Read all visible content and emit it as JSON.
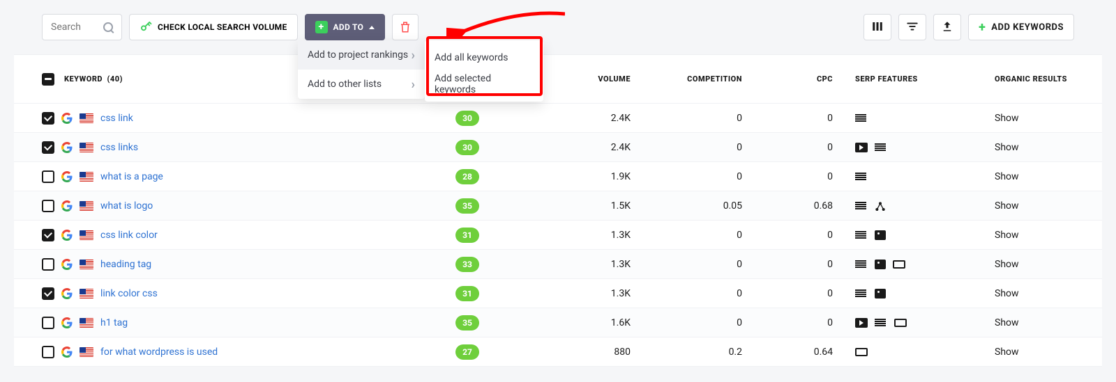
{
  "toolbar": {
    "search_placeholder": "Search",
    "check_local": "CHECK LOCAL SEARCH VOLUME",
    "add_to": "ADD TO",
    "add_keywords": "ADD KEYWORDS"
  },
  "dropdown": {
    "add_project": "Add to project rankings",
    "add_other": "Add to other lists",
    "sub_all": "Add all keywords",
    "sub_selected": "Add selected keywords"
  },
  "table": {
    "header": {
      "keyword": "KEYWORD",
      "keyword_count": "(40)",
      "volume": "VOLUME",
      "competition": "COMPETITION",
      "cpc": "CPC",
      "serp": "SERP FEATURES",
      "organic": "ORGANIC RESULTS"
    },
    "show_label": "Show",
    "rows": [
      {
        "checked": true,
        "keyword": "css link",
        "score": "30",
        "volume": "2.4K",
        "competition": "0",
        "cpc": "0",
        "serp": [
          "lines"
        ]
      },
      {
        "checked": true,
        "keyword": "css links",
        "score": "30",
        "volume": "2.4K",
        "competition": "0",
        "cpc": "0",
        "serp": [
          "video",
          "lines"
        ]
      },
      {
        "checked": false,
        "keyword": "what is a page",
        "score": "28",
        "volume": "1.9K",
        "competition": "0",
        "cpc": "0",
        "serp": [
          "lines"
        ]
      },
      {
        "checked": false,
        "keyword": "what is logo",
        "score": "35",
        "volume": "1.5K",
        "competition": "0.05",
        "cpc": "0.68",
        "serp": [
          "lines",
          "dots"
        ]
      },
      {
        "checked": true,
        "keyword": "css link color",
        "score": "31",
        "volume": "1.3K",
        "competition": "0",
        "cpc": "0",
        "serp": [
          "lines",
          "img"
        ]
      },
      {
        "checked": false,
        "keyword": "heading tag",
        "score": "33",
        "volume": "1.3K",
        "competition": "0",
        "cpc": "0",
        "serp": [
          "lines",
          "img",
          "box"
        ]
      },
      {
        "checked": true,
        "keyword": "link color css",
        "score": "31",
        "volume": "1.3K",
        "competition": "0",
        "cpc": "0",
        "serp": [
          "lines",
          "img"
        ]
      },
      {
        "checked": false,
        "keyword": "h1 tag",
        "score": "35",
        "volume": "1.6K",
        "competition": "0",
        "cpc": "0",
        "serp": [
          "video",
          "lines",
          "box"
        ]
      },
      {
        "checked": false,
        "keyword": "for what wordpress is used",
        "score": "27",
        "volume": "880",
        "competition": "0.2",
        "cpc": "0.64",
        "serp": [
          "box"
        ]
      }
    ]
  }
}
